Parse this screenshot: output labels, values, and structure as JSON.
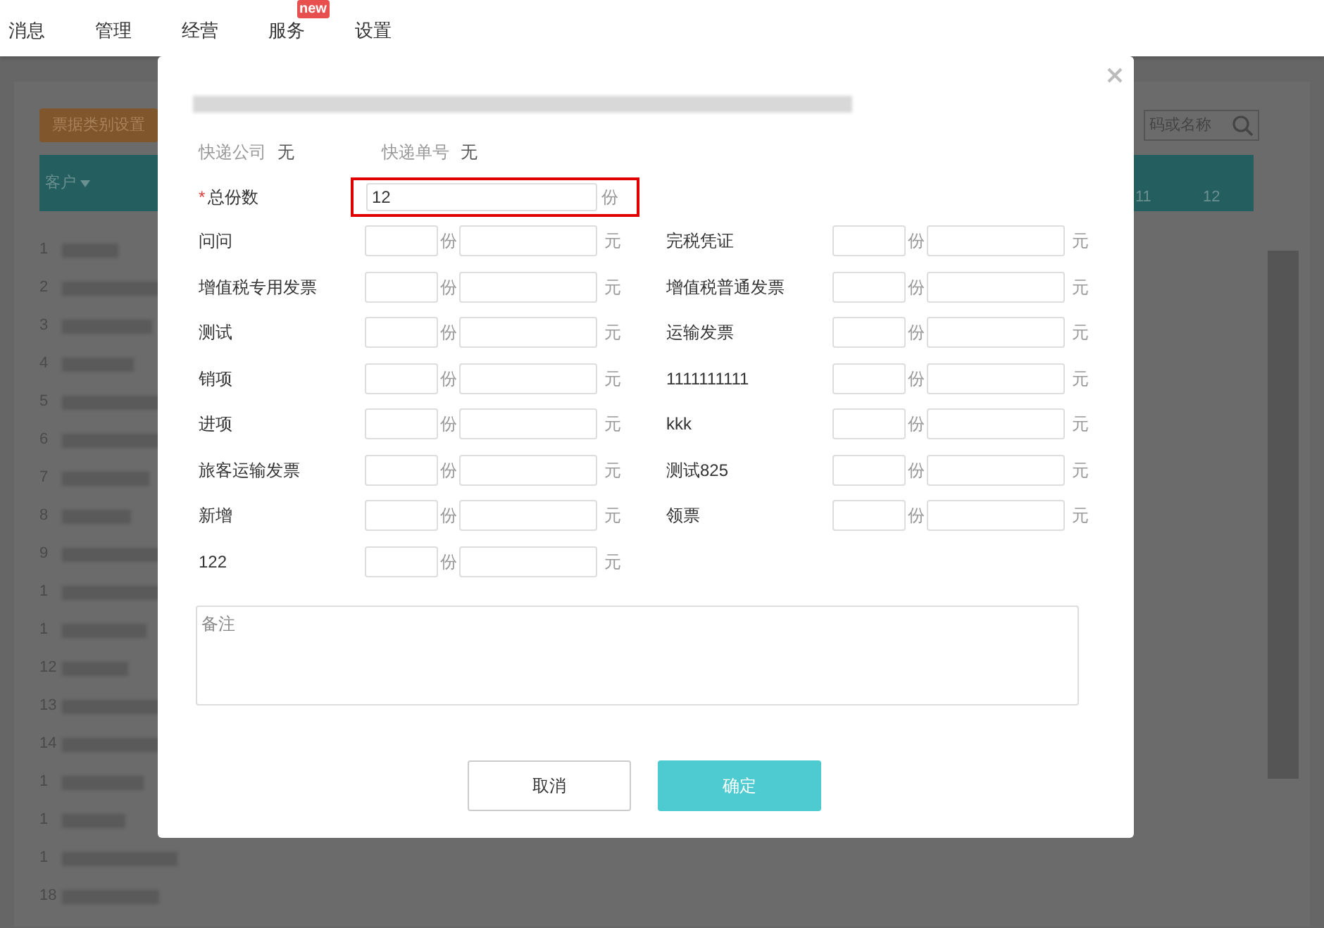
{
  "nav": [
    {
      "label": "消息"
    },
    {
      "label": "管理"
    },
    {
      "label": "经营"
    },
    {
      "label": "服务",
      "badge": "new"
    },
    {
      "label": "设置"
    }
  ],
  "background": {
    "settings_button": "票据类别设置",
    "customer_column": "客户",
    "search_placeholder": "码或名称",
    "header_numbers": [
      "11",
      "12"
    ],
    "row_numbers": [
      "1",
      "2",
      "3",
      "4",
      "5",
      "6",
      "7",
      "8",
      "9",
      "1",
      "1",
      "12",
      "13",
      "14",
      "1",
      "1",
      "1",
      "18"
    ]
  },
  "modal": {
    "courier_label": "快递公司",
    "courier_value": "无",
    "tracking_label": "快递单号",
    "tracking_value": "无",
    "total": {
      "label": "总份数",
      "required_mark": "*",
      "value": "12",
      "unit": "份",
      "highlighted": true
    },
    "items": [
      {
        "label": "问问",
        "count_unit": "份",
        "amount_unit": "元"
      },
      {
        "label": "完税凭证",
        "count_unit": "份",
        "amount_unit": "元"
      },
      {
        "label": "增值税专用发票",
        "count_unit": "份",
        "amount_unit": "元"
      },
      {
        "label": "增值税普通发票",
        "count_unit": "份",
        "amount_unit": "元"
      },
      {
        "label": "测试",
        "count_unit": "份",
        "amount_unit": "元"
      },
      {
        "label": "运输发票",
        "count_unit": "份",
        "amount_unit": "元"
      },
      {
        "label": "销项",
        "count_unit": "份",
        "amount_unit": "元"
      },
      {
        "label": "1111111111",
        "count_unit": "份",
        "amount_unit": "元"
      },
      {
        "label": "进项",
        "count_unit": "份",
        "amount_unit": "元"
      },
      {
        "label": "kkk",
        "count_unit": "份",
        "amount_unit": "元"
      },
      {
        "label": "旅客运输发票",
        "count_unit": "份",
        "amount_unit": "元"
      },
      {
        "label": "测试825",
        "count_unit": "份",
        "amount_unit": "元"
      },
      {
        "label": "新增",
        "count_unit": "份",
        "amount_unit": "元"
      },
      {
        "label": "领票",
        "count_unit": "份",
        "amount_unit": "元"
      },
      {
        "label": "122",
        "count_unit": "份",
        "amount_unit": "元"
      }
    ],
    "note": {
      "placeholder": "备注"
    },
    "buttons": [
      {
        "label": "取消",
        "kind": "secondary"
      },
      {
        "label": "确定",
        "kind": "primary"
      }
    ]
  }
}
